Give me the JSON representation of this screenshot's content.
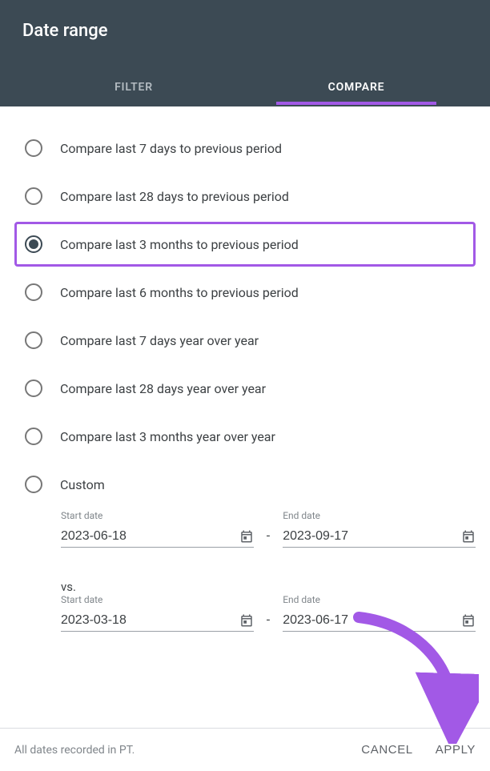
{
  "header": {
    "title": "Date range"
  },
  "tabs": {
    "filter": "FILTER",
    "compare": "COMPARE"
  },
  "options": [
    {
      "label": "Compare last 7 days to previous period",
      "selected": false
    },
    {
      "label": "Compare last 28 days to previous period",
      "selected": false
    },
    {
      "label": "Compare last 3 months to previous period",
      "selected": true
    },
    {
      "label": "Compare last 6 months to previous period",
      "selected": false
    },
    {
      "label": "Compare last 7 days year over year",
      "selected": false
    },
    {
      "label": "Compare last 28 days year over year",
      "selected": false
    },
    {
      "label": "Compare last 3 months year over year",
      "selected": false
    },
    {
      "label": "Custom",
      "selected": false
    }
  ],
  "dates": {
    "start_label": "Start date",
    "end_label": "End date",
    "vs_label": "vs.",
    "primary_start": "2023-06-18",
    "primary_end": "2023-09-17",
    "compare_start": "2023-03-18",
    "compare_end": "2023-06-17"
  },
  "footer": {
    "note": "All dates recorded in PT.",
    "cancel": "CANCEL",
    "apply": "APPLY"
  }
}
